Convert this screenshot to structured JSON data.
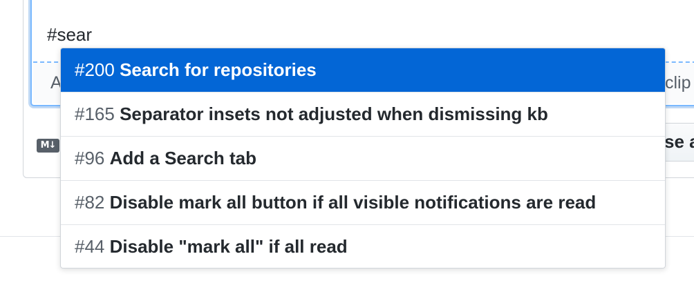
{
  "editor": {
    "text": "#sear"
  },
  "attach_bar": {
    "left_fragment": "A",
    "right_fragment": "clip"
  },
  "toolbar": {
    "markdown_icon": "markdown-icon",
    "markdown_icon_text": "M↓",
    "close_button_label": "se a"
  },
  "suggester": {
    "selected_index": 0,
    "items": [
      {
        "number": "#200",
        "title": "Search for repositories"
      },
      {
        "number": "#165",
        "title": "Separator insets not adjusted when dismissing kb"
      },
      {
        "number": "#96",
        "title": "Add a Search tab"
      },
      {
        "number": "#82",
        "title": "Disable mark all button if all visible notifications are read"
      },
      {
        "number": "#44",
        "title": "Disable \"mark all\" if all read"
      }
    ]
  },
  "colors": {
    "selection": "#0366d6",
    "focus_border": "#79b8ff",
    "text": "#24292e",
    "muted": "#586069"
  }
}
